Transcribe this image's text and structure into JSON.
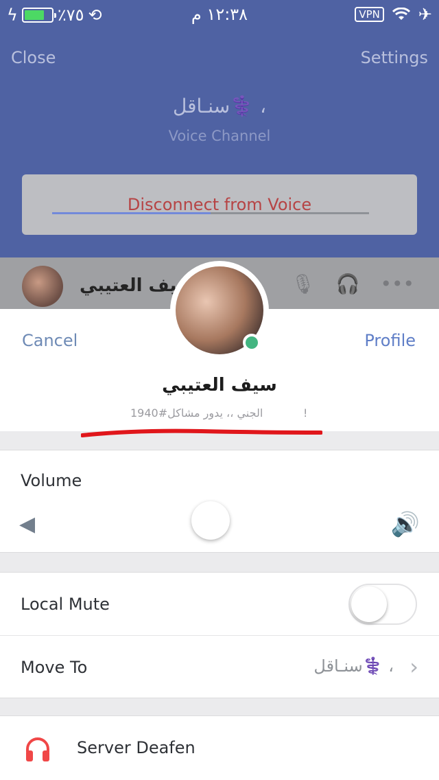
{
  "status_bar": {
    "battery_text": "٪٧٥",
    "battery_level": 0.75,
    "time": "١٢:٣٨ م",
    "vpn_label": "VPN"
  },
  "header": {
    "close_label": "Close",
    "settings_label": "Settings",
    "channel_name": "سنـاقل⚕️ ،",
    "channel_type": "Voice Channel",
    "disconnect_label": "Disconnect from Voice"
  },
  "voice_user_row": {
    "username": "سيف العتيبي"
  },
  "profile_sheet": {
    "cancel_label": "Cancel",
    "profile_label": "Profile",
    "display_name": "سيف العتيبي",
    "tag_text": "الجني ،، يدور مشاكل#1940",
    "tag_suffix": "!",
    "status": "online",
    "status_color": "#43b581"
  },
  "volume": {
    "label": "Volume",
    "level_fraction": 0.5,
    "accent_color": "#7289da"
  },
  "settings": {
    "local_mute_label": "Local Mute",
    "local_mute_on": false,
    "move_to_label": "Move To",
    "move_to_value": "سنـاقل⚕️ ،",
    "server_deafen_label": "Server Deafen",
    "deafen_icon_color": "#f04747"
  }
}
